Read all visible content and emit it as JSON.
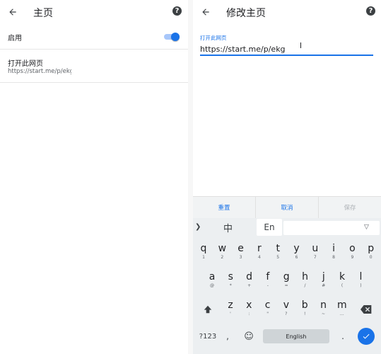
{
  "left_screen": {
    "title": "主页",
    "toggle_row": {
      "label": "启用",
      "enabled": true
    },
    "homepage_row": {
      "label": "打开此网页",
      "url": "https://start.me/p/ekg"
    }
  },
  "right_screen": {
    "title": "修改主页",
    "field_label": "打开此网页",
    "field_value": "https://start.me/p/ekg",
    "actions": {
      "reset": "重置",
      "cancel": "取消",
      "save": "保存"
    }
  },
  "keyboard": {
    "toolbar": {
      "chinese": "中",
      "english": "En"
    },
    "row1": [
      {
        "k": "q",
        "n": "1"
      },
      {
        "k": "w",
        "n": "2"
      },
      {
        "k": "e",
        "n": "3"
      },
      {
        "k": "r",
        "n": "4"
      },
      {
        "k": "t",
        "n": "5"
      },
      {
        "k": "y",
        "n": "6"
      },
      {
        "k": "u",
        "n": "7"
      },
      {
        "k": "i",
        "n": "8"
      },
      {
        "k": "o",
        "n": "9"
      },
      {
        "k": "p",
        "n": "0"
      }
    ],
    "row2": [
      {
        "k": "a",
        "n": "@"
      },
      {
        "k": "s",
        "n": "*"
      },
      {
        "k": "d",
        "n": "+"
      },
      {
        "k": "f",
        "n": "-"
      },
      {
        "k": "g",
        "n": "="
      },
      {
        "k": "h",
        "n": "/"
      },
      {
        "k": "j",
        "n": "#"
      },
      {
        "k": "k",
        "n": "("
      },
      {
        "k": "l",
        "n": ")"
      }
    ],
    "row3": [
      {
        "k": "z",
        "n": "'"
      },
      {
        "k": "x",
        "n": ":"
      },
      {
        "k": "c",
        "n": "\""
      },
      {
        "k": "v",
        "n": "?"
      },
      {
        "k": "b",
        "n": "!"
      },
      {
        "k": "n",
        "n": "~"
      },
      {
        "k": "m",
        "n": "…"
      }
    ],
    "symbols_label": "?123",
    "comma": ",",
    "space_label": "English",
    "period": "."
  },
  "colors": {
    "accent": "#1a73e8",
    "keyboard_bg": "#eceff1"
  }
}
